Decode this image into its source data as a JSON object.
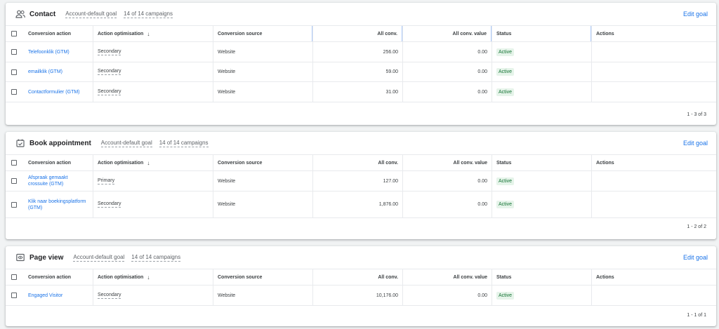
{
  "columns": {
    "conversion_action": "Conversion action",
    "action_optimisation": "Action optimisation",
    "conversion_source": "Conversion source",
    "all_conv": "All conv.",
    "all_conv_value": "All conv. value",
    "status": "Status",
    "actions": "Actions",
    "sort_arrow": "↓"
  },
  "colors": {
    "link": "#1a73e8",
    "active_bg": "#e6f4ea",
    "active_text": "#137333"
  },
  "goals": [
    {
      "title": "Contact",
      "icon": "people-icon",
      "default_goal": "Account-default goal",
      "campaigns": "14 of 14 campaigns",
      "edit": "Edit goal",
      "pager": "1 - 3 of 3",
      "rows": [
        {
          "name": "Telefoonklik (GTM)",
          "optimisation": "Secondary",
          "source": "Website",
          "all_conv": "256.00",
          "all_conv_value": "0.00",
          "status": "Active"
        },
        {
          "name": "emailklik (GTM)",
          "optimisation": "Secondary",
          "source": "Website",
          "all_conv": "59.00",
          "all_conv_value": "0.00",
          "status": "Active"
        },
        {
          "name": "Contactformulier (GTM)",
          "optimisation": "Secondary",
          "source": "Website",
          "all_conv": "31.00",
          "all_conv_value": "0.00",
          "status": "Active"
        }
      ]
    },
    {
      "title": "Book appointment",
      "icon": "calendar-check-icon",
      "default_goal": "Account-default goal",
      "campaigns": "14 of 14 campaigns",
      "edit": "Edit goal",
      "pager": "1 - 2 of 2",
      "rows": [
        {
          "name": "Afspraak gemaakt crossuite (GTM)",
          "optimisation": "Primary",
          "source": "Website",
          "all_conv": "127.00",
          "all_conv_value": "0.00",
          "status": "Active"
        },
        {
          "name": "Klik naar boekingsplatform (GTM)",
          "optimisation": "Secondary",
          "source": "Website",
          "all_conv": "1,876.00",
          "all_conv_value": "0.00",
          "status": "Active"
        }
      ]
    },
    {
      "title": "Page view",
      "icon": "page-view-icon",
      "default_goal": "Account-default goal",
      "campaigns": "14 of 14 campaigns",
      "edit": "Edit goal",
      "pager": "1 - 1 of 1",
      "rows": [
        {
          "name": "Engaged Visitor",
          "optimisation": "Secondary",
          "source": "Website",
          "all_conv": "10,176.00",
          "all_conv_value": "0.00",
          "status": "Active"
        }
      ]
    }
  ]
}
